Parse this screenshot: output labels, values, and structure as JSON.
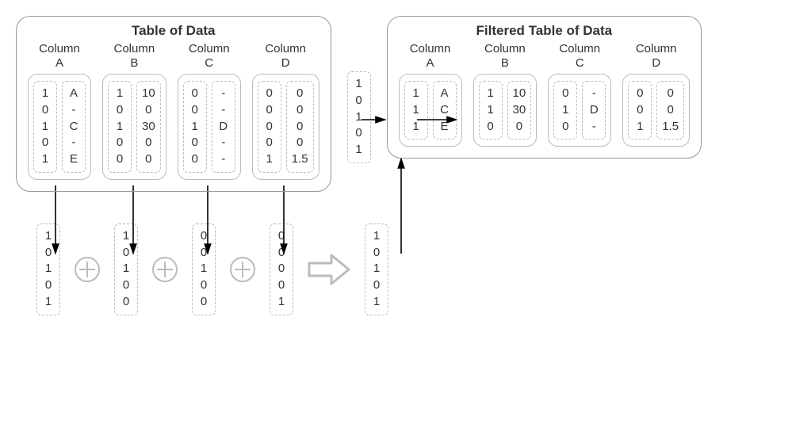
{
  "left_panel": {
    "title": "Table of Data",
    "columns": [
      {
        "label": "Column\nA",
        "mask": [
          "1",
          "0",
          "1",
          "0",
          "1"
        ],
        "values": [
          "A",
          "-",
          "C",
          "-",
          "E"
        ]
      },
      {
        "label": "Column\nB",
        "mask": [
          "1",
          "0",
          "1",
          "0",
          "0"
        ],
        "values": [
          "10",
          "0",
          "30",
          "0",
          "0"
        ]
      },
      {
        "label": "Column\nC",
        "mask": [
          "0",
          "0",
          "1",
          "0",
          "0"
        ],
        "values": [
          "-",
          "-",
          "D",
          "-",
          "-"
        ]
      },
      {
        "label": "Column\nD",
        "mask": [
          "0",
          "0",
          "0",
          "0",
          "1"
        ],
        "values": [
          "0",
          "0",
          "0",
          "0",
          "1.5"
        ]
      }
    ]
  },
  "mid_mask": [
    "1",
    "0",
    "1",
    "0",
    "1"
  ],
  "right_panel": {
    "title": "Filtered Table of Data",
    "columns": [
      {
        "label": "Column\nA",
        "mask": [
          "1",
          "1",
          "1"
        ],
        "values": [
          "A",
          "C",
          "E"
        ]
      },
      {
        "label": "Column\nB",
        "mask": [
          "1",
          "1",
          "0"
        ],
        "values": [
          "10",
          "30",
          "0"
        ]
      },
      {
        "label": "Column\nC",
        "mask": [
          "0",
          "1",
          "0"
        ],
        "values": [
          "-",
          "D",
          "-"
        ]
      },
      {
        "label": "Column\nD",
        "mask": [
          "0",
          "0",
          "1"
        ],
        "values": [
          "0",
          "0",
          "1.5"
        ]
      }
    ]
  },
  "bottom_vectors": [
    [
      "1",
      "0",
      "1",
      "0",
      "1"
    ],
    [
      "1",
      "0",
      "1",
      "0",
      "0"
    ],
    [
      "0",
      "0",
      "1",
      "0",
      "0"
    ],
    [
      "0",
      "0",
      "0",
      "0",
      "1"
    ]
  ],
  "bottom_result": [
    "1",
    "0",
    "1",
    "0",
    "1"
  ]
}
